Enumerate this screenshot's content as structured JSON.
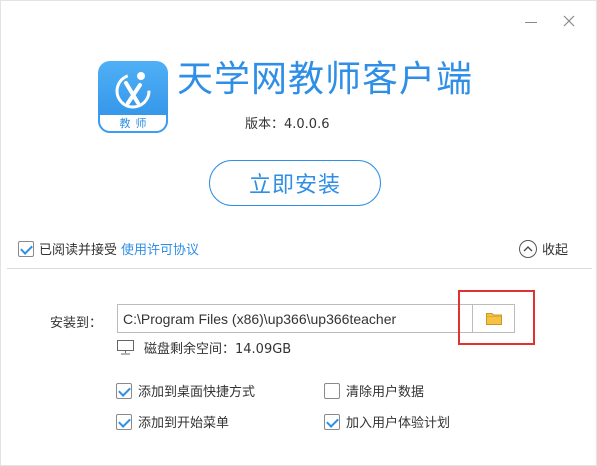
{
  "app": {
    "title": "天学网教师客户端",
    "version_text": "版本：4.0.0.6",
    "logo_label": "教师"
  },
  "actions": {
    "install_label": "立即安装"
  },
  "agreement": {
    "checked": true,
    "text": "已阅读并接受",
    "link_text": "使用许可协议"
  },
  "collapse": {
    "label": "收起"
  },
  "install_path": {
    "label": "安装到：",
    "value": "C:\\Program Files (x86)\\up366\\up366teacher"
  },
  "disk": {
    "text": "磁盘剩余空间：14.09GB"
  },
  "options": [
    {
      "label": "添加到桌面快捷方式",
      "checked": true
    },
    {
      "label": "清除用户数据",
      "checked": false
    },
    {
      "label": "添加到开始菜单",
      "checked": true
    },
    {
      "label": "加入用户体验计划",
      "checked": true
    }
  ],
  "colors": {
    "accent": "#2f8fe6",
    "highlight": "#e0332f",
    "folder": "#f5c242"
  },
  "icons": {
    "minimize": "minimize-icon",
    "close": "close-icon",
    "collapse": "chevron-up-icon",
    "browse": "folder-icon",
    "disk": "monitor-icon"
  }
}
